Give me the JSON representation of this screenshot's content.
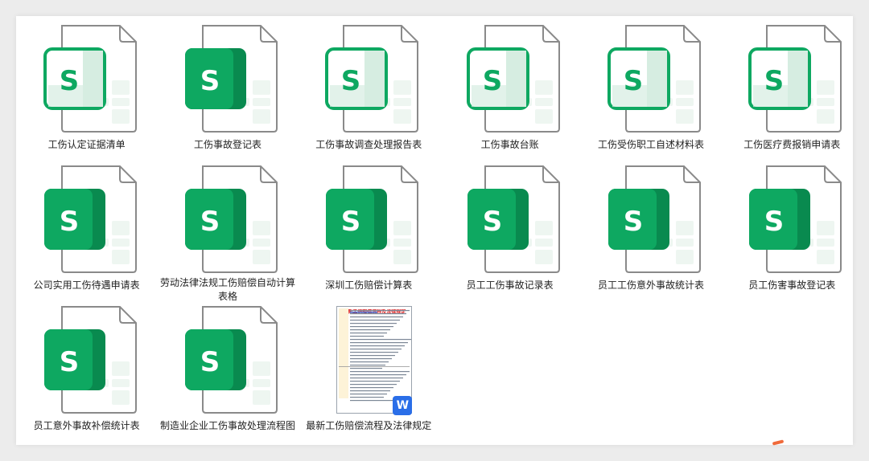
{
  "colors": {
    "sheet_green": "#0ea861",
    "sheet_dark": "#098a4f",
    "sheet_light": "#d6ede1",
    "word_blue": "#2a6ee8",
    "doc_title_red": "#dd2222"
  },
  "files": [
    {
      "name": "工伤认定证据清单",
      "type": "sheet",
      "style": "outline",
      "icon": "spreadsheet-icon"
    },
    {
      "name": "工伤事故登记表",
      "type": "sheet",
      "style": "solid",
      "icon": "spreadsheet-icon"
    },
    {
      "name": "工伤事故调查处理报告表",
      "type": "sheet",
      "style": "outline",
      "icon": "spreadsheet-icon"
    },
    {
      "name": "工伤事故台账",
      "type": "sheet",
      "style": "outline",
      "icon": "spreadsheet-icon"
    },
    {
      "name": "工伤受伤职工自述材料表",
      "type": "sheet",
      "style": "outline",
      "icon": "spreadsheet-icon"
    },
    {
      "name": "工伤医疗费报销申请表",
      "type": "sheet",
      "style": "outline",
      "icon": "spreadsheet-icon"
    },
    {
      "name": "公司实用工伤待遇申请表",
      "type": "sheet",
      "style": "solid",
      "icon": "spreadsheet-icon"
    },
    {
      "name": "劳动法律法规工伤赔偿自动计算表格",
      "type": "sheet",
      "style": "solid",
      "icon": "spreadsheet-icon"
    },
    {
      "name": "深圳工伤赔偿计算表",
      "type": "sheet",
      "style": "solid",
      "icon": "spreadsheet-icon"
    },
    {
      "name": "员工工伤事故记录表",
      "type": "sheet",
      "style": "solid",
      "icon": "spreadsheet-icon"
    },
    {
      "name": "员工工伤意外事故统计表",
      "type": "sheet",
      "style": "solid",
      "icon": "spreadsheet-icon"
    },
    {
      "name": "员工伤害事故登记表",
      "type": "sheet",
      "style": "solid",
      "icon": "spreadsheet-icon"
    },
    {
      "name": "员工意外事故补偿统计表",
      "type": "sheet",
      "style": "solid",
      "icon": "spreadsheet-icon"
    },
    {
      "name": "制造业企业工伤事故处理流程图",
      "type": "sheet",
      "style": "solid",
      "icon": "spreadsheet-icon"
    },
    {
      "name": "最新工伤赔偿流程及法律规定",
      "type": "doc",
      "icon": "word-document-icon",
      "badge": "W",
      "preview_title": "最新工伤赔偿流程及法律规定"
    }
  ]
}
